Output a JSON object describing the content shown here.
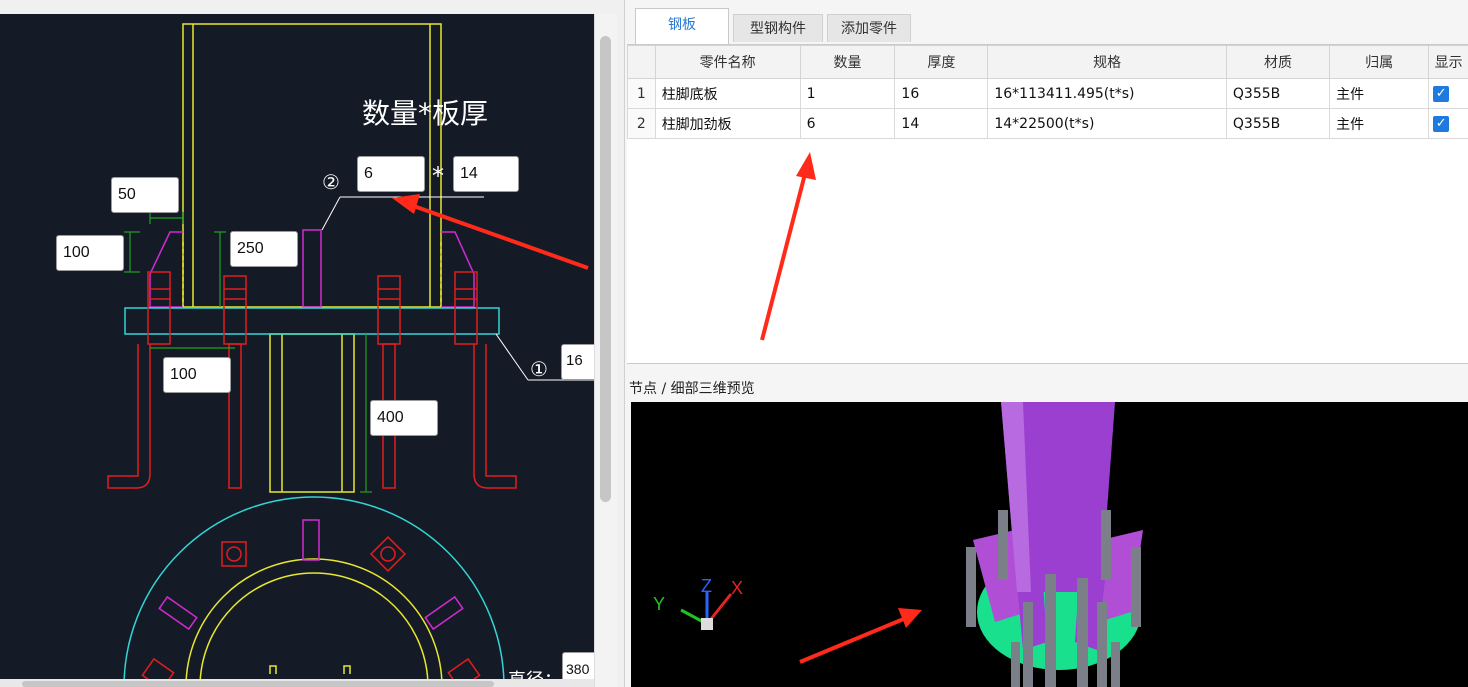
{
  "cad": {
    "annotation_title": "数量*板厚",
    "stiffener_count": "6",
    "stiffener_thickness": "14",
    "multiply_sign": "*",
    "callout_2": "②",
    "callout_1": "①",
    "base_thickness": "16",
    "dim_top_offset": "50",
    "dim_left_height": "100",
    "dim_stiffener_height": "250",
    "dim_bolt_spacing": "100",
    "dim_anchor_length": "400",
    "diameter_label": "直径：",
    "diameter_value": "380"
  },
  "tabs": [
    {
      "label": "钢板",
      "active": true
    },
    {
      "label": "型钢构件",
      "active": false
    },
    {
      "label": "添加零件",
      "active": false
    }
  ],
  "table": {
    "headers": [
      "零件名称",
      "数量",
      "厚度",
      "规格",
      "材质",
      "归属",
      "显示"
    ],
    "rows": [
      {
        "index": "1",
        "name": "柱脚底板",
        "qty": "1",
        "thickness": "16",
        "spec": "16*113411.495(t*s)",
        "material": "Q355B",
        "owner": "主件",
        "checked": "✓"
      },
      {
        "index": "2",
        "name": "柱脚加劲板",
        "qty": "6",
        "thickness": "14",
        "spec": "14*22500(t*s)",
        "material": "Q355B",
        "owner": "主件",
        "checked": "✓"
      }
    ]
  },
  "preview": {
    "title": "节点 / 细部三维预览",
    "axis_x": "X",
    "axis_y": "Y",
    "axis_z": "Z"
  },
  "colors": {
    "cad_bg": "#151b26",
    "column": "#e8e830",
    "stiffener": "#d22ad2",
    "base_plate": "#31d6d6",
    "bolts": "#e01e1e",
    "dimension": "#1fa31f",
    "annotation_arrow": "#ff2a1a",
    "preview_column": "#9b3fd1",
    "preview_base": "#18e08c"
  }
}
